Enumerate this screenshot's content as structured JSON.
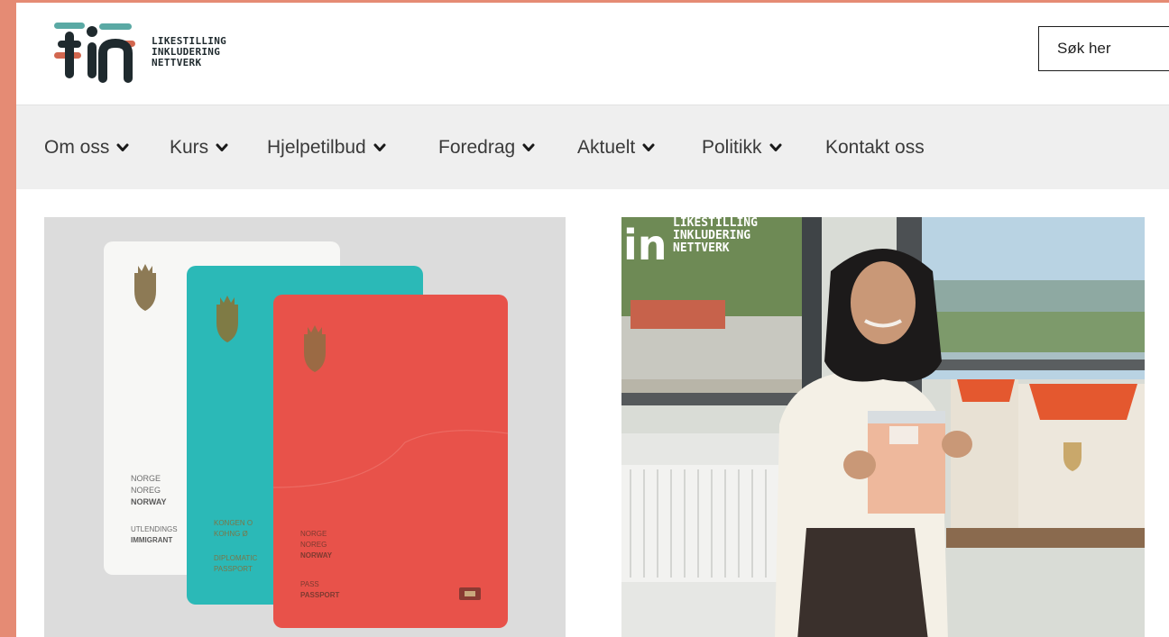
{
  "header": {
    "logo": {
      "mark": "tin",
      "lines": [
        "LIKESTILLING",
        "INKLUDERING",
        "NETTVERK"
      ]
    },
    "search": {
      "placeholder": "Søk her"
    }
  },
  "nav": {
    "items": [
      {
        "label": "Om oss",
        "dropdown": true
      },
      {
        "label": "Kurs",
        "dropdown": true
      },
      {
        "label": "Hjelpetilbud",
        "dropdown": true
      },
      {
        "label": "Foredrag",
        "dropdown": true
      },
      {
        "label": "Aktuelt",
        "dropdown": true
      },
      {
        "label": "Politikk",
        "dropdown": true
      },
      {
        "label": "Kontakt oss",
        "dropdown": false
      }
    ]
  },
  "cards": {
    "passports": {
      "white": {
        "lines": [
          "NORGE",
          "NOREG",
          "NORWAY",
          "UTLENDINGS",
          "IMMIGRANT"
        ]
      },
      "teal": {
        "lines": [
          "KONGEN O",
          "KOHNG Ø",
          "DIPLOMATIC",
          "PASSPORT"
        ]
      },
      "red": {
        "lines": [
          "NORGE",
          "NOREG",
          "NORWAY",
          "PASS",
          "PASSPORT"
        ]
      }
    },
    "photo": {
      "watermark": {
        "mark": "in",
        "lines": [
          "LIKESTILLING",
          "INKLUDERING",
          "NETTVERK"
        ]
      }
    }
  },
  "colors": {
    "frame": "#e58b74",
    "logo_teal": "#5aa9a4",
    "logo_red": "#d2674f",
    "logo_dark": "#1f2a2e",
    "passport_teal": "#2bb9b7",
    "passport_red": "#e8524a"
  }
}
